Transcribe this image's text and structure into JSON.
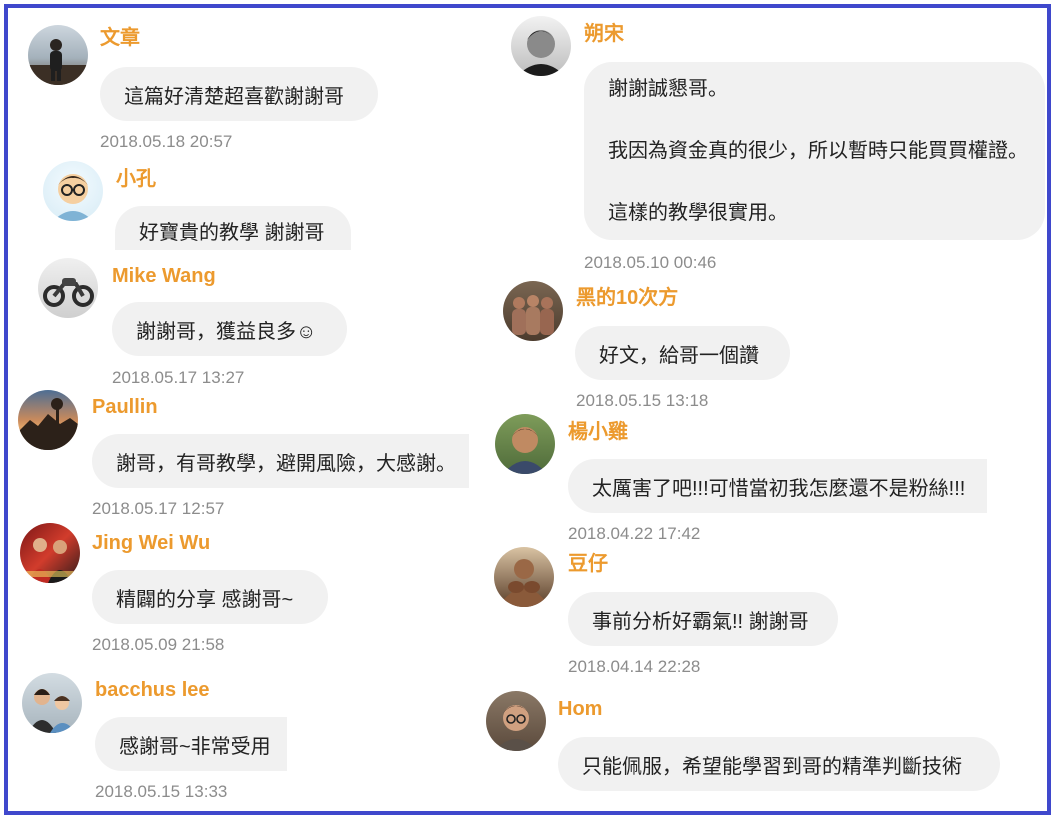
{
  "colors": {
    "frame": "#3f48cc",
    "name": "#ec9a2e",
    "bubble": "#f1f1f1",
    "timestamp": "#8c8c8c",
    "text": "#222222"
  },
  "left_column": [
    {
      "name": "文章",
      "text": "這篇好清楚超喜歡謝謝哥",
      "time": "2018.05.18 20:57"
    },
    {
      "name": "小孔",
      "text": "好寶貴的教學 謝謝哥"
    },
    {
      "name": "Mike Wang",
      "text": "謝謝哥，獲益良多☺",
      "time": "2018.05.17 13:27"
    },
    {
      "name": "Paullin",
      "text": "謝哥，有哥教學，避開風險，大感謝。",
      "time": "2018.05.17 12:57"
    },
    {
      "name": "Jing Wei Wu",
      "text": "精闢的分享 感謝哥~",
      "time": "2018.05.09 21:58"
    },
    {
      "name": "bacchus lee",
      "text": "感謝哥~非常受用",
      "time": "2018.05.15 13:33"
    }
  ],
  "right_column": [
    {
      "name": "朔宋",
      "lines": [
        "謝謝誠懇哥。",
        "我因為資金真的很少，所以暫時只能買買權證。",
        "這樣的教學很實用。"
      ],
      "time": "2018.05.10 00:46"
    },
    {
      "name": "黑的10次方",
      "text": "好文，給哥一個讚",
      "time": "2018.05.15 13:18"
    },
    {
      "name": "楊小雞",
      "text": "太厲害了吧!!!可惜當初我怎麼還不是粉絲!!!",
      "time": "2018.04.22 17:42"
    },
    {
      "name": "豆仔",
      "text": "事前分析好霸氣!! 謝謝哥",
      "time": "2018.04.14 22:28"
    },
    {
      "name": "Hom",
      "text": "只能佩服，希望能學習到哥的精準判斷技術"
    }
  ]
}
